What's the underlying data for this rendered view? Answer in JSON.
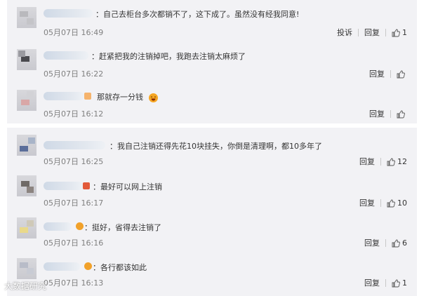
{
  "comments": [
    {
      "text": "：自己去柜台多次都销不了，这下成了。虽然没有经我同意!",
      "date": "05月07日 16:49",
      "report": "投诉",
      "reply": "回复",
      "likes": "1"
    },
    {
      "text": "：赶紧把我的注销掉吧，我跑去注销太麻烦了",
      "date": "05月07日 16:22",
      "reply": "回复",
      "likes": ""
    },
    {
      "text": "那就存一分钱",
      "date": "05月07日 16:12",
      "reply": "回复",
      "likes": ""
    },
    {
      "text": "：我自己注销还得先花10块挂失，你倒是清理啊，都10多年了",
      "date": "05月07日 16:25",
      "reply": "回复",
      "likes": "12"
    },
    {
      "text": "：最好可以网上注销",
      "date": "05月07日 16:17",
      "reply": "回复",
      "likes": "10"
    },
    {
      "text": "：挺好，省得去注销了",
      "date": "05月07日 16:16",
      "reply": "回复",
      "likes": "6"
    },
    {
      "text": "：各行都该如此",
      "date": "05月07日 16:13",
      "reply": "回复",
      "likes": "1"
    }
  ],
  "watermark": "大数据研究",
  "colors": {
    "panel_bg": "#f2f2f5",
    "text": "#333333",
    "date": "#808080",
    "emoji": "#f6a623"
  },
  "icons": {
    "like": "thumbs-up-icon",
    "emoji": "laughing-face-icon"
  }
}
